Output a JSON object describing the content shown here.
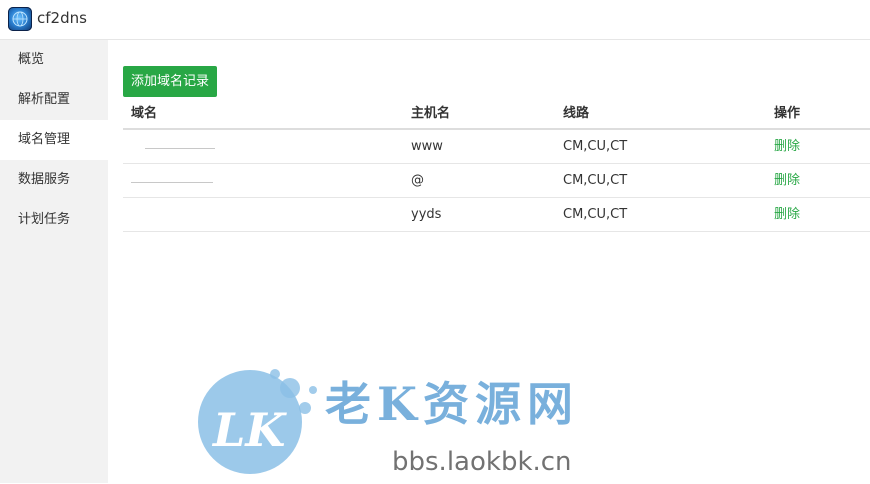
{
  "app": {
    "title": "cf2dns",
    "logo_icon": "globe-logo-icon"
  },
  "sidebar": {
    "items": [
      {
        "label": "概览",
        "active": false
      },
      {
        "label": "解析配置",
        "active": false
      },
      {
        "label": "域名管理",
        "active": true
      },
      {
        "label": "数据服务",
        "active": false
      },
      {
        "label": "计划任务",
        "active": false
      }
    ]
  },
  "toolbar": {
    "add_label": "添加域名记录"
  },
  "table": {
    "headers": [
      "域名",
      "主机名",
      "线路",
      "操作"
    ],
    "rows": [
      {
        "domain": "",
        "host": "www",
        "line": "CM,CU,CT",
        "action": "删除"
      },
      {
        "domain": "",
        "host": "@",
        "line": "CM,CU,CT",
        "action": "删除"
      },
      {
        "domain": "",
        "host": "yyds",
        "line": "CM,CU,CT",
        "action": "删除"
      }
    ]
  },
  "watermark": {
    "text": "老K资源网",
    "url": "bbs.laokbk.cn"
  },
  "colors": {
    "accent": "#28a745",
    "sidebar_bg": "#f2f2f2",
    "watermark": "#6ba8d9"
  }
}
